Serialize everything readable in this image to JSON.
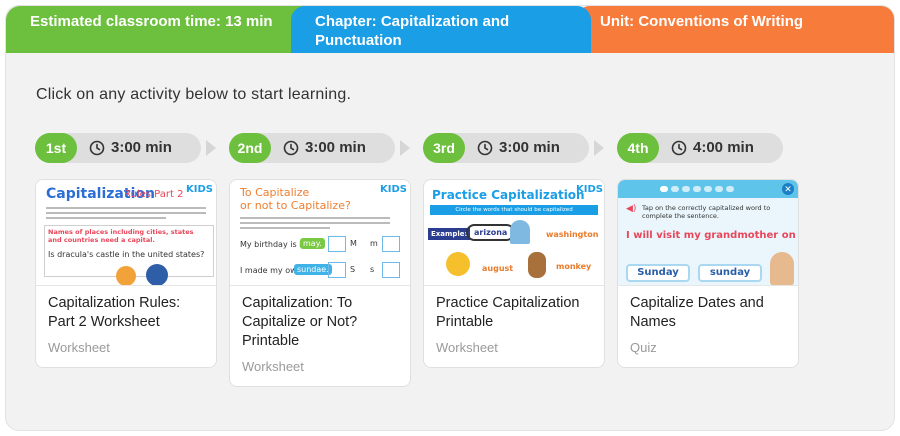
{
  "header": {
    "time": "Estimated classroom time: 13 min",
    "chapter": "Chapter: Capitalization and Punctuation",
    "unit": "Unit: Conventions of Writing"
  },
  "intro": "Click on any activity below to start learning.",
  "steps": [
    {
      "ordinal": "1st",
      "duration": "3:00 min"
    },
    {
      "ordinal": "2nd",
      "duration": "3:00 min"
    },
    {
      "ordinal": "3rd",
      "duration": "3:00 min"
    },
    {
      "ordinal": "4th",
      "duration": "4:00 min"
    }
  ],
  "cards": [
    {
      "title": "Capitalization Rules: Part 2 Worksheet",
      "type": "Worksheet",
      "thumb": {
        "heading": "Capitalization",
        "heading2": "Rules Part 2",
        "names_note": "Names of places including cities, states and countries need a capital.",
        "sentence": "Is dracula's castle in the united states?"
      }
    },
    {
      "title": "Capitalization: To Capitalize or Not? Printable",
      "type": "Worksheet",
      "thumb": {
        "heading1": "To Capitalize",
        "heading2": "or not to Capitalize?",
        "row1": "My birthday is in",
        "row1_word": "may.",
        "row2": "I made my own",
        "row2_word": "sundae.",
        "letters": [
          "M",
          "m",
          "S",
          "s"
        ]
      }
    },
    {
      "title": "Practice Capitalization Printable",
      "type": "Worksheet",
      "thumb": {
        "heading": "Practice Capitalization",
        "subheading": "Circle the words that should be capitalized",
        "example": "Example:",
        "words": [
          "arizona",
          "washington",
          "august",
          "monkey"
        ]
      }
    },
    {
      "title": "Capitalize Dates and Names",
      "type": "Quiz",
      "thumb": {
        "instruction": "Tap on the correctly capitalized word to complete the sentence.",
        "sentence": "I will visit my grandmother on ______.",
        "options": [
          "Sunday",
          "sunday"
        ]
      }
    }
  ],
  "brand": "KIDS"
}
